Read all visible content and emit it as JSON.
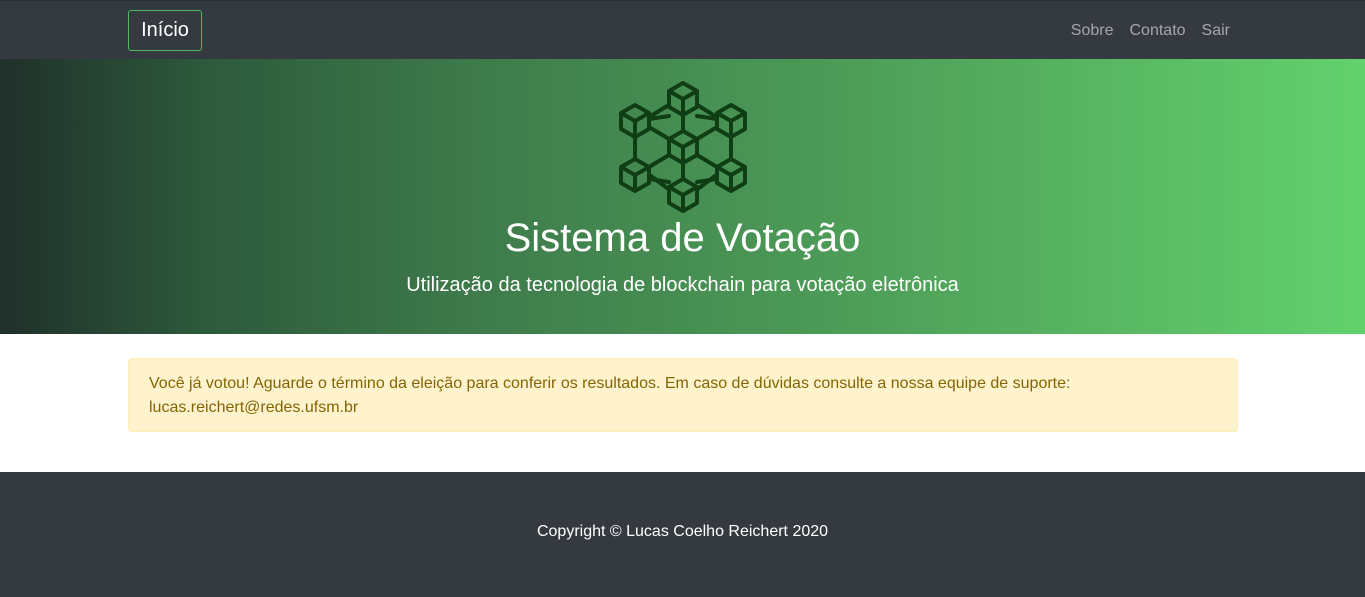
{
  "navbar": {
    "brand_label": "Início",
    "links": [
      {
        "label": "Sobre"
      },
      {
        "label": "Contato"
      },
      {
        "label": "Sair"
      }
    ]
  },
  "hero": {
    "logo_icon": "blockchain-cubes-icon",
    "title": "Sistema de Votação",
    "subtitle": "Utilização da tecnologia de blockchain para votação eletrônica"
  },
  "alert": {
    "message": "Você já votou! Aguarde o término da eleição para conferir os resultados. Em caso de dúvidas consulte a nossa equipe de suporte: lucas.reichert@redes.ufsm.br"
  },
  "footer": {
    "copyright": "Copyright © Lucas Coelho Reichert 2020"
  },
  "colors": {
    "navbar_bg": "#343a40",
    "brand_border": "#4cbb5f",
    "hero_gradient_start": "#20302a",
    "hero_gradient_end": "#62d16d",
    "alert_bg": "#fff3cd",
    "alert_text": "#856404",
    "logo_stroke": "#0f3d14"
  }
}
